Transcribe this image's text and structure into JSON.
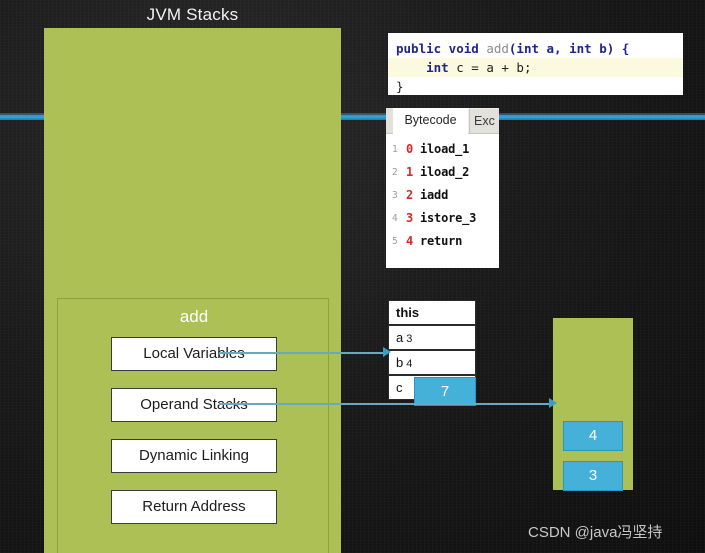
{
  "title": "JVM Stacks",
  "watermark": "CSDN @java冯坚持",
  "colors": {
    "green_panel": "#adc055",
    "blue_value": "#45b0d8",
    "blue_line": "#39a9dd",
    "board": "#1a1a1a",
    "arrow": "#6aa9bd"
  },
  "code_panel": {
    "line1": {
      "kw1": "public void",
      "method": " add",
      "rest": "(int a, int b) {"
    },
    "line2": {
      "kw": "    int",
      "rest": " c = a + b;"
    },
    "line3": {
      "text": "}"
    }
  },
  "bytecode_panel": {
    "tab_active": "Bytecode",
    "tab_next": "Exc",
    "rows": [
      {
        "num": "1",
        "offset": "0",
        "op": "iload_1"
      },
      {
        "num": "2",
        "offset": "1",
        "op": "iload_2"
      },
      {
        "num": "3",
        "offset": "2",
        "op": "iadd"
      },
      {
        "num": "4",
        "offset": "3",
        "op": "istore_3"
      },
      {
        "num": "5",
        "offset": "4",
        "op": "return"
      }
    ]
  },
  "jvm_stack_panel": {
    "frame": {
      "name": "add",
      "boxes": [
        {
          "label": "Local Variables"
        },
        {
          "label": "Operand Stacks"
        },
        {
          "label": "Dynamic Linking"
        },
        {
          "label": "Return Address"
        }
      ]
    }
  },
  "local_variable_table": {
    "rows": [
      {
        "name": "this",
        "index": ""
      },
      {
        "name": "a",
        "index": "3"
      },
      {
        "name": "b",
        "index": "4"
      },
      {
        "name": "c",
        "index": ""
      }
    ],
    "highlight_value": "7"
  },
  "operand_stack": {
    "cells": [
      {
        "value": "4"
      },
      {
        "value": "3"
      }
    ]
  }
}
